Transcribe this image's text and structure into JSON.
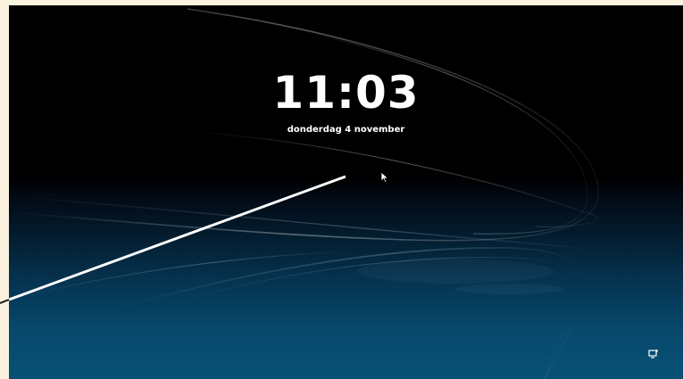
{
  "lockscreen": {
    "time": "11:03",
    "date": "donderdag 4 november"
  },
  "icons": {
    "cursor": "mouse-pointer-icon",
    "network": "network-status-icon"
  },
  "colors": {
    "background_top": "#000000",
    "background_bottom": "#075175",
    "text": "#ffffff",
    "outer_frame": "#fbf3df"
  }
}
